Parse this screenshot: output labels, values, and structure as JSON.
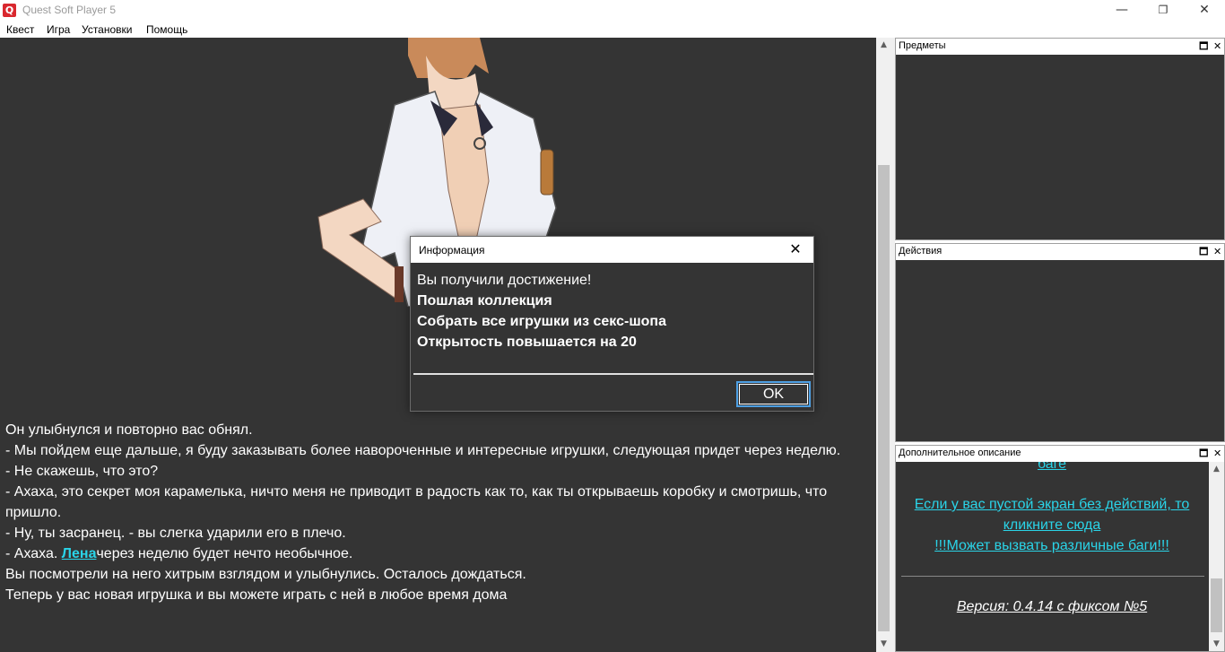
{
  "window": {
    "title": "Quest Soft Player 5",
    "icon_letter": "Q",
    "minimize_glyph": "—",
    "maximize_glyph": "❐",
    "close_glyph": "✕"
  },
  "menu": {
    "items": [
      "Квест",
      "Игра",
      "Установки",
      "Помощь"
    ]
  },
  "story": {
    "lines": [
      "Он улыбнулся и повторно вас обнял.",
      "- Мы пойдем еще дальше, я буду заказывать более навороченные и интересные игрушки, следующая придет через неделю.",
      "- Не скажешь, что это?",
      "- Ахаха, это секрет моя карамелька, ничто меня не приводит в радость как то, как ты открываешь коробку и смотришь, что пришло.",
      "- Ну, ты засранец. - вы слегка ударили его в плечо.",
      "Вы посмотрели на него хитрым взглядом и улыбнулись. Осталось дождаться.",
      "Теперь у вас новая игрушка и вы можете играть с ней в любое время дома"
    ],
    "link_line_prefix": "- Ахаха. ",
    "link_name": "Лена",
    "link_line_suffix": "через неделю будет нечто необычное."
  },
  "panels": {
    "items_title": "Предметы",
    "actions_title": "Действия",
    "description_title": "Дополнительное описание",
    "restore_glyph": "🗖",
    "close_glyph": "✕"
  },
  "description": {
    "top_link_fragment": "баге",
    "empty_screen_link": "Если у вас пустой экран без действий, то кликните сюда",
    "bugs_warning_link": "!!!Может вызвать различные баги!!!",
    "version": "Версия: 0.4.14 с фиксом №5"
  },
  "dialog": {
    "title": "Информация",
    "close_glyph": "✕",
    "line1": "Вы получили достижение!",
    "line2": "Пошлая коллекция",
    "line3": "Собрать все игрушки из секс-шопа",
    "line4": "Открытость повышается на 20",
    "ok_label": "OK"
  },
  "colors": {
    "pane_bg": "#343434",
    "link": "#2ad4e8",
    "focus_border": "#4d9fe3"
  }
}
